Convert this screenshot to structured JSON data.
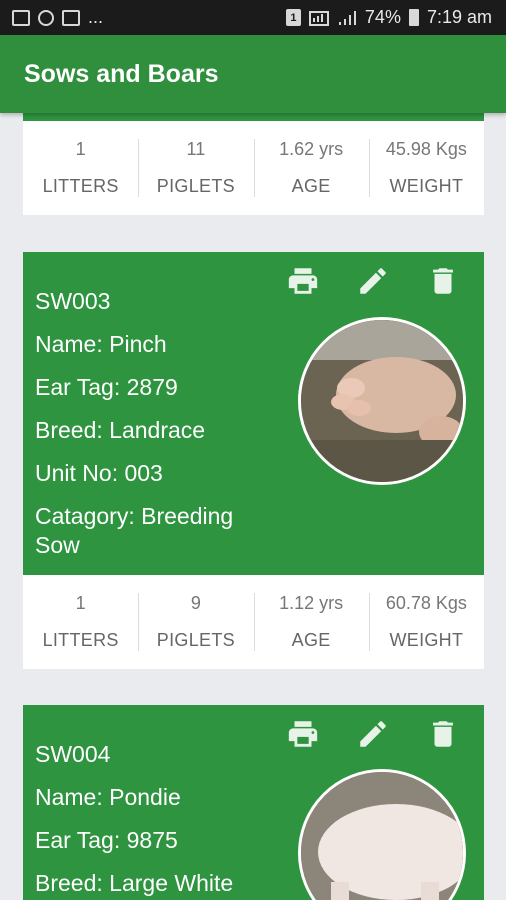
{
  "status_bar": {
    "more": "...",
    "battery": "74%",
    "time": "7:19 am",
    "sim_badge": "1"
  },
  "app_bar": {
    "title": "Sows and Boars"
  },
  "stat_labels": {
    "litters": "LITTERS",
    "piglets": "PIGLETS",
    "age": "AGE",
    "weight": "WEIGHT"
  },
  "cards": [
    {
      "stats": {
        "litters": "1",
        "piglets": "11",
        "age": "1.62 yrs",
        "weight": "45.98 Kgs"
      }
    },
    {
      "id": "SW003",
      "name": "Name: Pinch",
      "ear_tag": "Ear Tag: 2879",
      "breed": "Breed: Landrace",
      "unit": "Unit No: 003",
      "category": "Catagory: Breeding Sow",
      "stats": {
        "litters": "1",
        "piglets": "9",
        "age": "1.12 yrs",
        "weight": "60.78 Kgs"
      }
    },
    {
      "id": "SW004",
      "name": "Name: Pondie",
      "ear_tag": "Ear Tag: 9875",
      "breed": "Breed: Large White"
    }
  ],
  "icons": {
    "print": "printer-icon",
    "edit": "pencil-icon",
    "delete": "trash-icon"
  },
  "colors": {
    "primary": "#2f8f3d",
    "card": "#2e9440",
    "background": "#e9ebef"
  }
}
